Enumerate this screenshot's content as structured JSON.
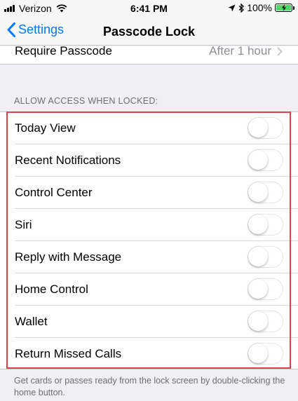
{
  "status_bar": {
    "carrier": "Verizon",
    "time": "6:41 PM",
    "battery_percent": "100%",
    "battery_level": 1.0,
    "icons": [
      "signal-bars-icon",
      "wifi-icon",
      "location-arrow-icon",
      "bluetooth-icon",
      "battery-charging-icon"
    ]
  },
  "nav": {
    "back_label": "Settings",
    "title": "Passcode Lock"
  },
  "require_passcode": {
    "label": "Require Passcode",
    "value": "After 1 hour"
  },
  "section": {
    "header": "ALLOW ACCESS WHEN LOCKED:",
    "rows": [
      {
        "label": "Today View",
        "on": false
      },
      {
        "label": "Recent Notifications",
        "on": false
      },
      {
        "label": "Control Center",
        "on": false
      },
      {
        "label": "Siri",
        "on": false
      },
      {
        "label": "Reply with Message",
        "on": false
      },
      {
        "label": "Home Control",
        "on": false
      },
      {
        "label": "Wallet",
        "on": false
      },
      {
        "label": "Return Missed Calls",
        "on": false
      }
    ],
    "footer": "Get cards or passes ready from the lock screen by double-clicking the home button."
  },
  "colors": {
    "accent": "#007aff",
    "highlight_border": "#e0404a",
    "battery_fill": "#4cd964"
  }
}
